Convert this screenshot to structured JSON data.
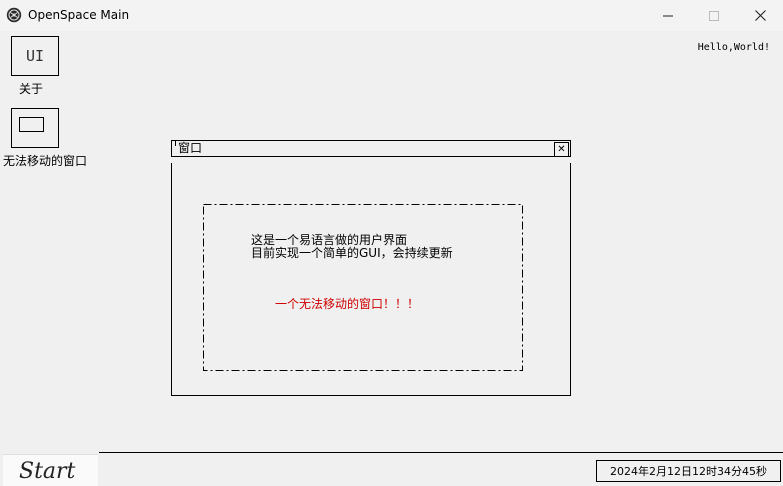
{
  "window": {
    "title": "OpenSpace Main",
    "minimize_icon": "minimize-icon",
    "maximize_icon": "maximize-icon",
    "close_icon": "close-icon"
  },
  "greeting": "Hello,World!",
  "desktop_icons": [
    {
      "glyph": "UI",
      "label": "关于"
    },
    {
      "glyph": "",
      "label": "无法移动的窗口"
    }
  ],
  "inner_window": {
    "title": "窗口",
    "close_glyph": "✕",
    "description_line1": "这是一个易语言做的用户界面",
    "description_line2": "目前实现一个简单的GUI，会持续更新",
    "notice": "一个无法移动的窗口！！！",
    "notice_color": "#cc0000"
  },
  "taskbar": {
    "start_label": "Start",
    "clock": "2024年2月12日12时34分45秒"
  }
}
